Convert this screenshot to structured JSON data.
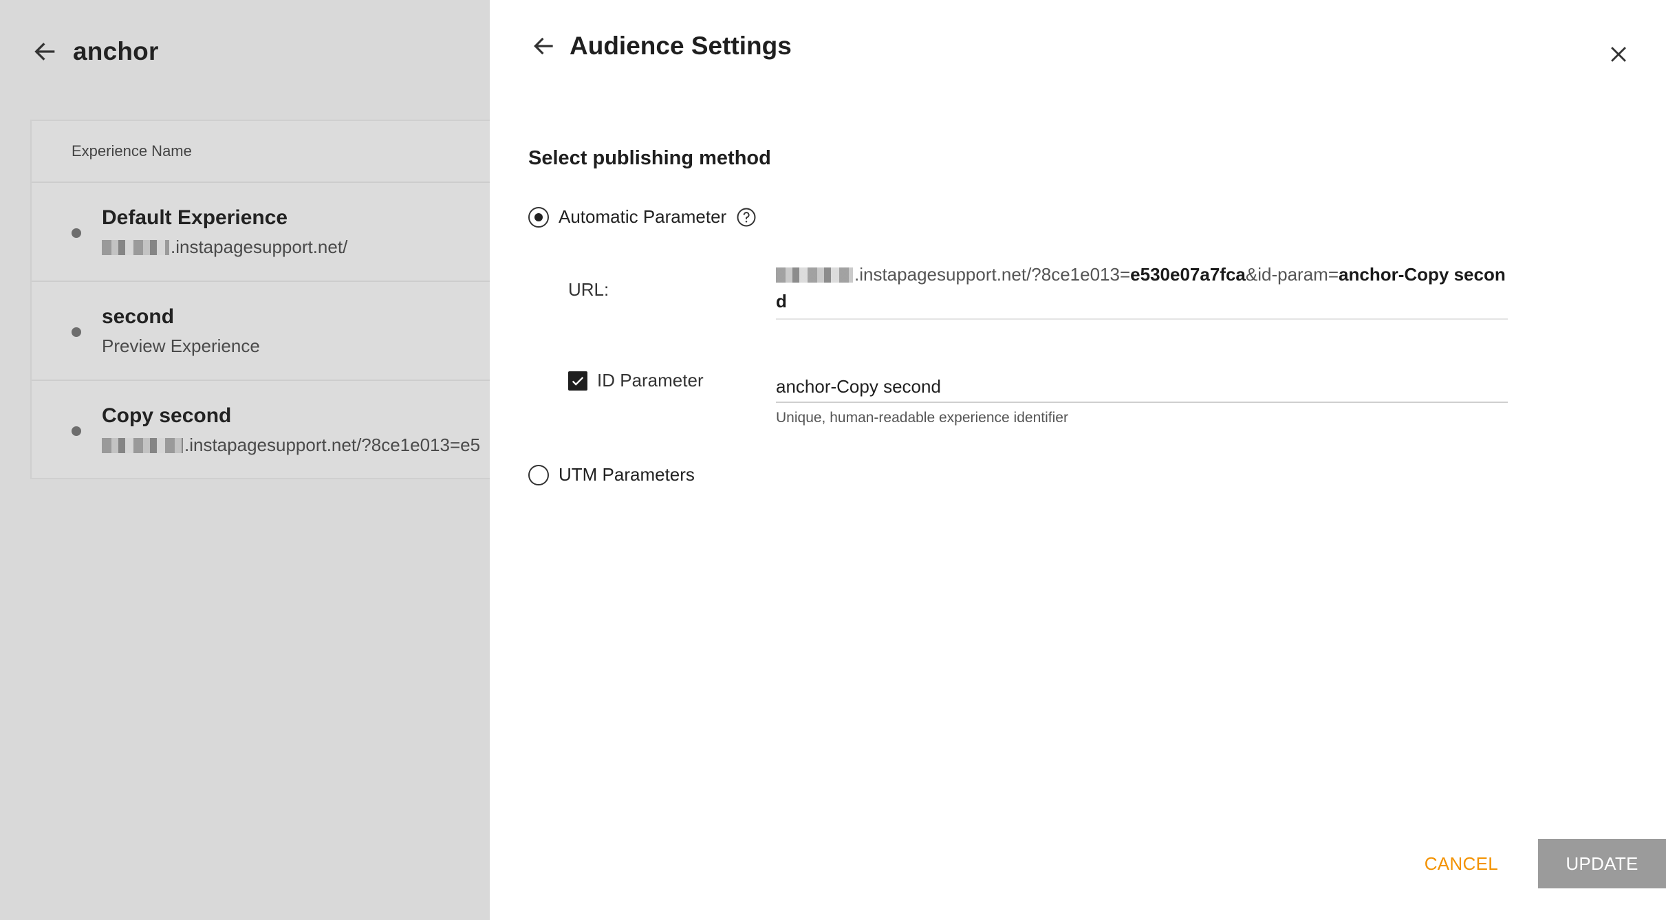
{
  "background": {
    "title": "anchor",
    "table": {
      "header": "Experience Name",
      "rows": [
        {
          "name": "Default Experience",
          "sub": ".instapagesupport.net/"
        },
        {
          "name": "second",
          "sub": "Preview Experience"
        },
        {
          "name": "Copy second",
          "sub": ".instapagesupport.net/?8ce1e013=e5"
        }
      ]
    }
  },
  "drawer": {
    "title": "Audience Settings",
    "section_title": "Select publishing method",
    "automatic_label": "Automatic Parameter",
    "url_label": "URL:",
    "url": {
      "prefix": ".instapagesupport.net/?8ce1e013=",
      "hash": "e530e07a7fca",
      "mid": "&id-param=",
      "id": "anchor-Copy second"
    },
    "id_param_label": "ID Parameter",
    "id_param_value": "anchor-Copy second",
    "id_param_help": "Unique, human-readable experience identifier",
    "utm_label": "UTM Parameters",
    "cancel_label": "CANCEL",
    "update_label": "UPDATE"
  },
  "colors": {
    "accent_orange": "#f39200",
    "update_button": "#9b9b9b"
  },
  "icons": [
    "back-arrow-icon",
    "close-icon",
    "help-circle-icon",
    "check-icon"
  ]
}
